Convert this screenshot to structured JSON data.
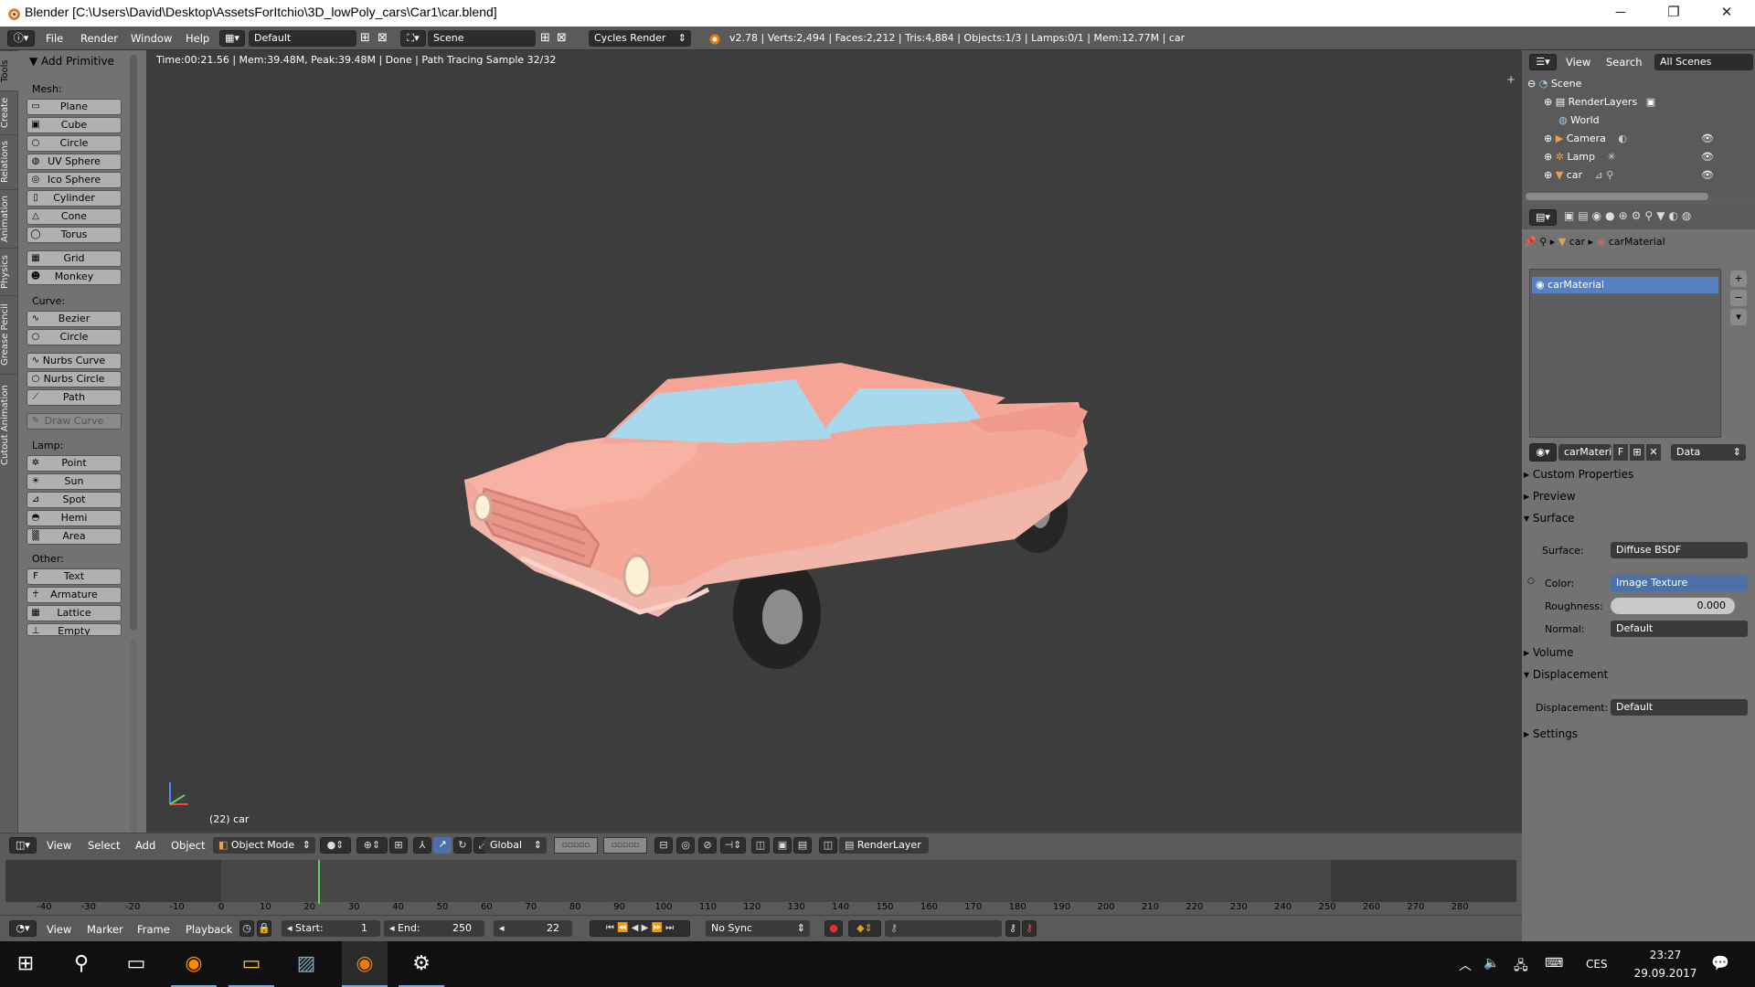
{
  "window": {
    "title": "Blender [C:\\Users\\David\\Desktop\\AssetsForItchio\\3D_lowPoly_cars\\Car1\\car.blend]",
    "minimize": "─",
    "restore": "❐",
    "close": "✕"
  },
  "info_header": {
    "menus": [
      "File",
      "Render",
      "Window",
      "Help"
    ],
    "layout": "Default",
    "scene": "Scene",
    "engine": "Cycles Render",
    "stats": "v2.78 | Verts:2,494 | Faces:2,212 | Tris:4,884 | Objects:1/3 | Lamps:0/1 | Mem:12.77M | car"
  },
  "toolshelf": {
    "tabs": [
      "Tools",
      "Create",
      "Relations",
      "Animation",
      "Physics",
      "Grease Pencil",
      "Cutout Animation"
    ],
    "panel_title": "Add Primitive",
    "mesh_label": "Mesh:",
    "mesh": [
      "Plane",
      "Cube",
      "Circle",
      "UV Sphere",
      "Ico Sphere",
      "Cylinder",
      "Cone",
      "Torus"
    ],
    "mesh2": [
      "Grid",
      "Monkey"
    ],
    "curve_label": "Curve:",
    "curve": [
      "Bezier",
      "Circle"
    ],
    "curve2": [
      "Nurbs Curve",
      "Nurbs Circle",
      "Path"
    ],
    "draw_curve": "Draw Curve",
    "lamp_label": "Lamp:",
    "lamp": [
      "Point",
      "Sun",
      "Spot",
      "Hemi",
      "Area"
    ],
    "other_label": "Other:",
    "other": [
      "Text",
      "Armature",
      "Lattice",
      "Empty"
    ]
  },
  "viewport": {
    "render_info": "Time:00:21.56 | Mem:39.48M, Peak:39.48M | Done | Path Tracing Sample 32/32",
    "object_label": "(22) car",
    "car_body": "#f4a89a",
    "car_glass": "#a9d8ec"
  },
  "viewport_header": {
    "menus": [
      "View",
      "Select",
      "Add",
      "Object"
    ],
    "mode": "Object Mode",
    "orientation": "Global",
    "render_layer": "RenderLayer"
  },
  "timeline": {
    "ticks": [
      "-40",
      "-30",
      "-20",
      "-10",
      "0",
      "10",
      "20",
      "30",
      "40",
      "50",
      "60",
      "70",
      "80",
      "90",
      "100",
      "110",
      "120",
      "130",
      "140",
      "150",
      "160",
      "170",
      "180",
      "190",
      "200",
      "210",
      "220",
      "230",
      "240",
      "250",
      "260",
      "270",
      "280"
    ],
    "current_frame": 22,
    "menus": [
      "View",
      "Marker",
      "Frame",
      "Playback"
    ],
    "start_label": "Start:",
    "start": "1",
    "end_label": "End:",
    "end": "250",
    "frame": "22",
    "sync": "No Sync"
  },
  "outliner": {
    "menus": [
      "View",
      "Search"
    ],
    "filter": "All Scenes",
    "items": [
      "Scene",
      "RenderLayers",
      "World",
      "Camera",
      "Lamp",
      "car"
    ]
  },
  "properties": {
    "breadcrumb_obj": "car",
    "breadcrumb_mat": "carMaterial",
    "slot": "carMaterial",
    "mat_field": "carMateri",
    "fake_user": "F",
    "link": "Data",
    "panels": {
      "custom": "Custom Properties",
      "preview": "Preview",
      "surface": "Surface",
      "volume": "Volume",
      "displacement": "Displacement",
      "settings": "Settings"
    },
    "surface_label": "Surface:",
    "surface_val": "Diffuse BSDF",
    "color_label": "Color:",
    "color_val": "Image Texture",
    "rough_label": "Roughness:",
    "rough_val": "0.000",
    "normal_label": "Normal:",
    "normal_val": "Default",
    "disp_label": "Displacement:",
    "disp_val": "Default"
  },
  "taskbar": {
    "lang": "CES",
    "time": "23:27",
    "date": "29.09.2017"
  }
}
